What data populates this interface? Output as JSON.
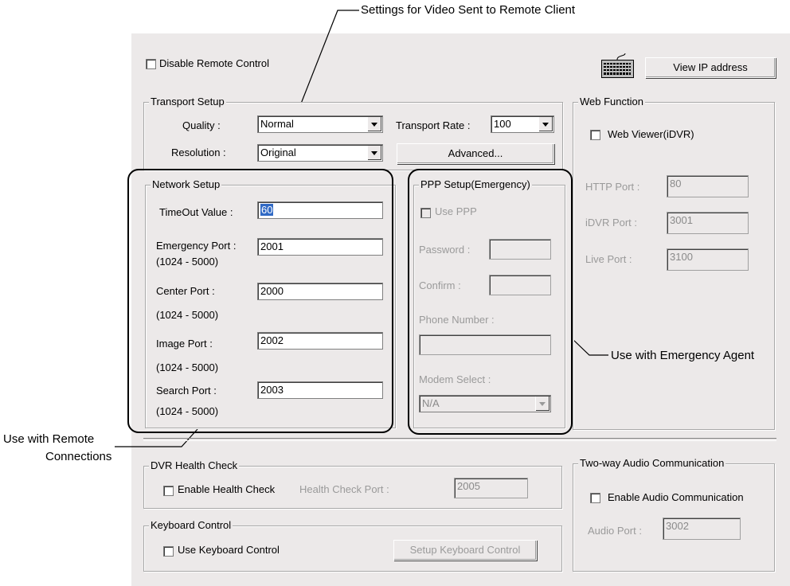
{
  "annotations": {
    "top": "Settings for Video Sent to Remote Client",
    "emergency": "Use with Emergency Agent",
    "remote_line1": "Use with Remote",
    "remote_line2": "Connections"
  },
  "disable_remote_control": "Disable Remote Control",
  "view_ip_button": "View IP address",
  "transport": {
    "title": "Transport Setup",
    "quality_label": "Quality :",
    "quality_value": "Normal",
    "resolution_label": "Resolution :",
    "resolution_value": "Original",
    "rate_label": "Transport Rate :",
    "rate_value": "100",
    "advanced_button": "Advanced..."
  },
  "web": {
    "title": "Web Function",
    "viewer_label": "Web Viewer(iDVR)",
    "http_label": "HTTP Port :",
    "http_value": "80",
    "idvr_label": "iDVR Port :",
    "idvr_value": "3001",
    "live_label": "Live Port :",
    "live_value": "3100"
  },
  "network": {
    "title": "Network Setup",
    "timeout_label": "TimeOut Value :",
    "timeout_value": "60",
    "emergency_label": "Emergency Port :",
    "emergency_value": "2001",
    "center_label": "Center Port :",
    "center_value": "2000",
    "image_label": "Image Port :",
    "image_value": "2002",
    "search_label": "Search Port :",
    "search_value": "2003",
    "range": "(1024 - 5000)"
  },
  "ppp": {
    "title": "PPP Setup(Emergency)",
    "use_label": "Use PPP",
    "password_label": "Password :",
    "confirm_label": "Confirm :",
    "phone_label": "Phone Number :",
    "modem_label": "Modem Select :",
    "modem_value": "N/A"
  },
  "health": {
    "title": "DVR Health Check",
    "enable_label": "Enable Health Check",
    "port_label": "Health Check Port :",
    "port_value": "2005"
  },
  "keyboard": {
    "title": "Keyboard Control",
    "use_label": "Use Keyboard Control",
    "setup_button": "Setup Keyboard Control"
  },
  "audio": {
    "title": "Two-way Audio Communication",
    "enable_label": "Enable Audio Communication",
    "port_label": "Audio Port :",
    "port_value": "3002"
  }
}
